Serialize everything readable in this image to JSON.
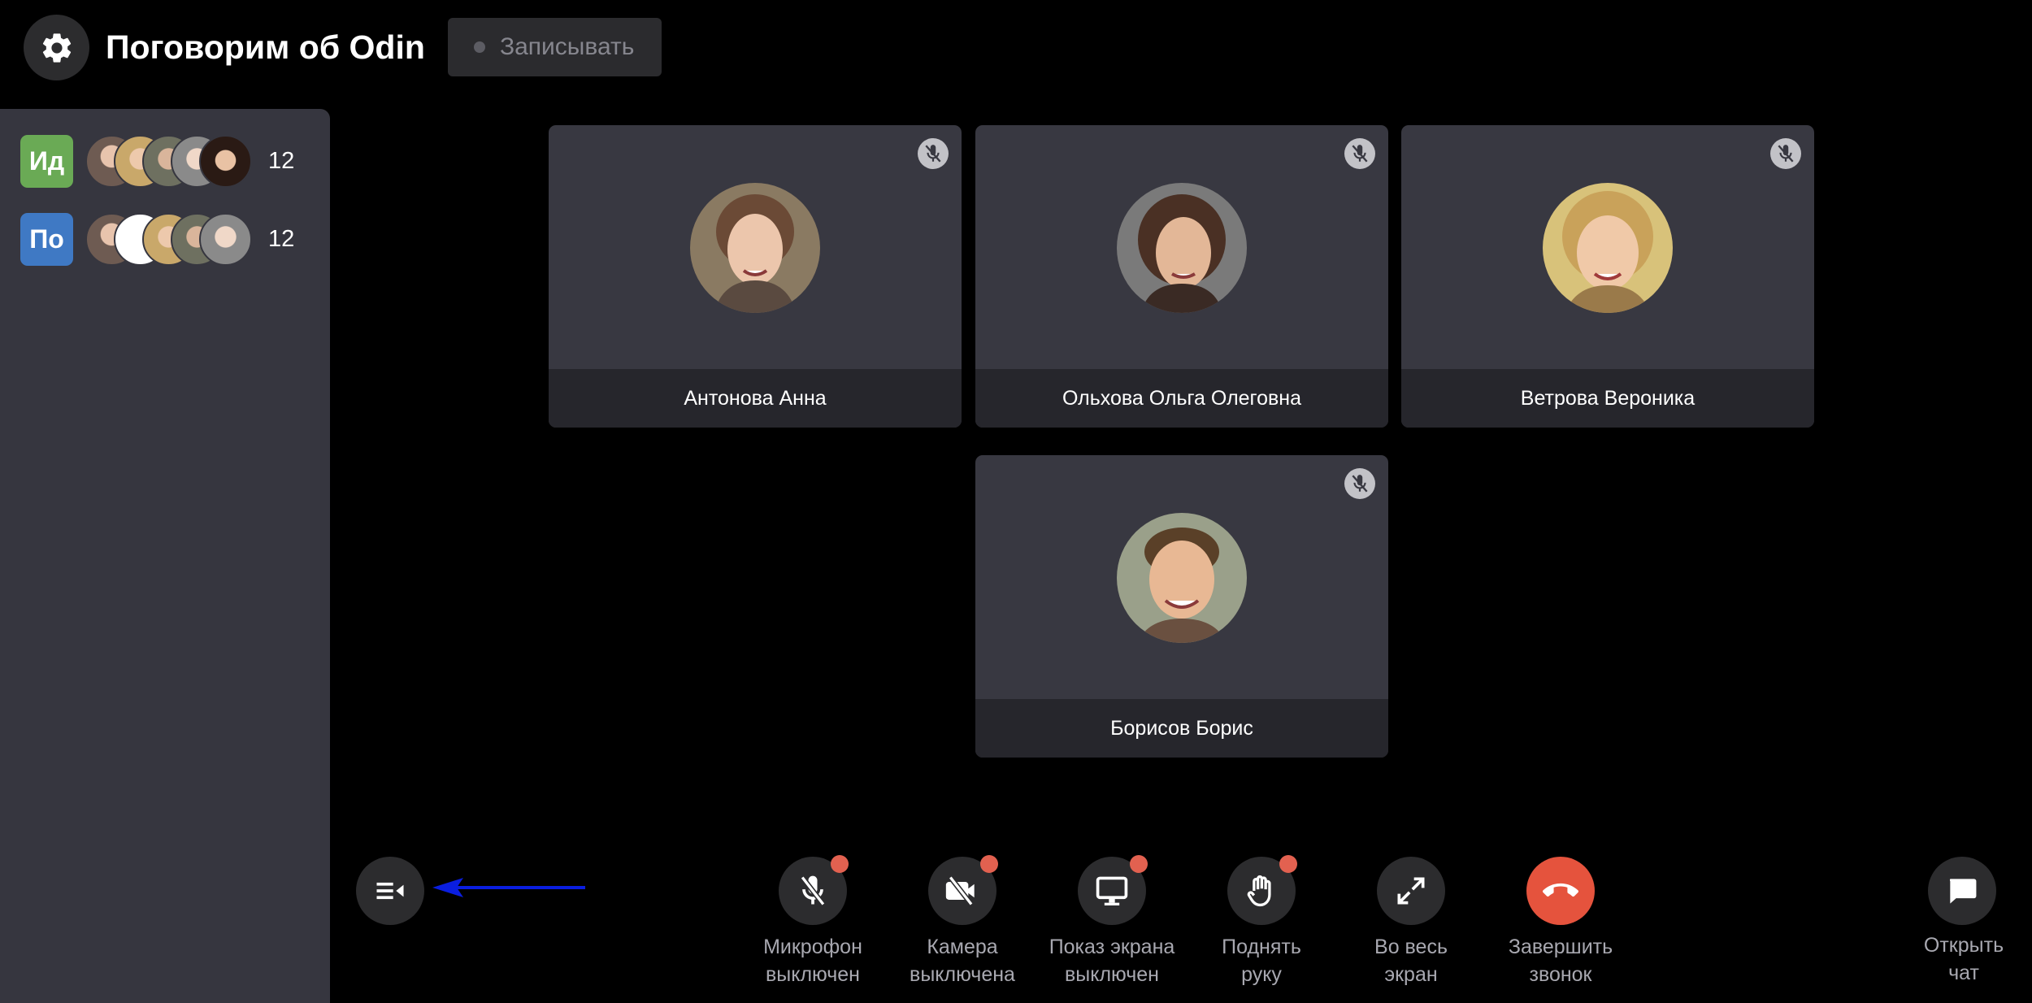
{
  "header": {
    "title": "Поговорим об Odin",
    "record_label": "Записывать"
  },
  "sidebar": {
    "rooms": [
      {
        "badge": "Ид",
        "badge_color": "#6aaa55",
        "count": "12"
      },
      {
        "badge": "По",
        "badge_color": "#3f79c4",
        "count": "12"
      }
    ]
  },
  "participants": [
    {
      "name": "Антонова Анна"
    },
    {
      "name": "Ольхова Ольга Олеговна"
    },
    {
      "name": "Ветрова Вероника"
    },
    {
      "name": "Борисов Борис"
    }
  ],
  "controls": {
    "mic": {
      "line1": "Микрофон",
      "line2": "выключен"
    },
    "camera": {
      "line1": "Камера",
      "line2": "выключена"
    },
    "screen": {
      "line1": "Показ экрана",
      "line2": "выключен"
    },
    "hand": {
      "line1": "Поднять",
      "line2": "руку"
    },
    "fullscreen": {
      "line1": "Во весь",
      "line2": "экран"
    },
    "end_call": {
      "line1": "Завершить",
      "line2": "звонок"
    },
    "chat": {
      "line1": "Открыть",
      "line2": "чат"
    }
  },
  "colors": {
    "end_call": "#e5533d",
    "notification_dot": "#e26150",
    "annotation_arrow": "#0a1ee0"
  },
  "icons": [
    "gear-icon",
    "record-dot-icon",
    "mic-off-icon",
    "camera-off-icon",
    "monitor-icon",
    "hand-icon",
    "expand-icon",
    "phone-hangup-icon",
    "chat-icon",
    "list-toggle-icon"
  ]
}
